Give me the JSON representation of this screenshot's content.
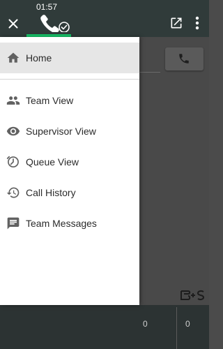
{
  "topbar": {
    "timer": "01:57",
    "call_status": "connected",
    "colors": {
      "background": "#303b3a",
      "accent": "#17c469"
    },
    "icons": [
      "close-icon",
      "phone-check-icon",
      "open-in-new-icon",
      "more-vert-icon"
    ]
  },
  "drawer": {
    "items": [
      {
        "label": "Home",
        "icon": "home-icon",
        "selected": true
      },
      {
        "label": "Team View",
        "icon": "team-icon"
      },
      {
        "label": "Supervisor View",
        "icon": "eye-icon"
      },
      {
        "label": "Queue View",
        "icon": "queue-timer-icon"
      },
      {
        "label": "Call History",
        "icon": "history-icon"
      },
      {
        "label": "Team Messages",
        "icon": "message-icon"
      }
    ]
  },
  "background": {
    "counts": [
      "0",
      "0"
    ]
  }
}
